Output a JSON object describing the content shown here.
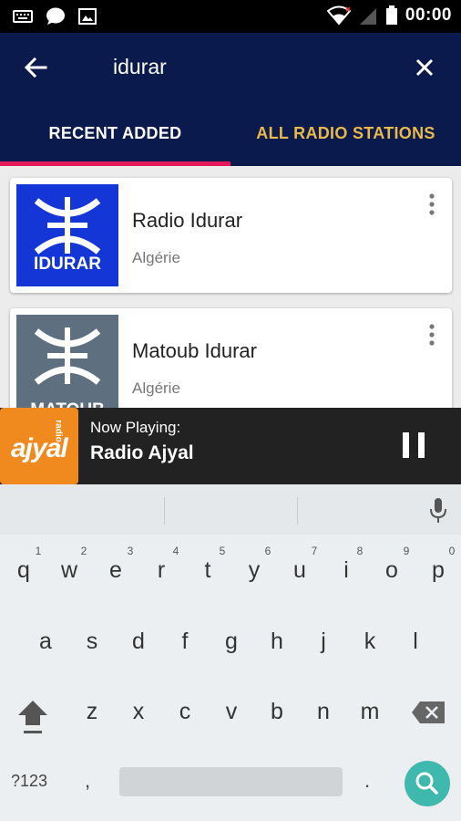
{
  "status_bar": {
    "time": "00:00"
  },
  "search": {
    "query": "idurar"
  },
  "tabs": [
    {
      "label": "RECENT ADDED",
      "active": true
    },
    {
      "label": "ALL RADIO STATIONS",
      "active": false
    }
  ],
  "stations": [
    {
      "name": "Radio Idurar",
      "country": "Algérie",
      "logo_text": "IDURAR",
      "logo_color": "#1536d6"
    },
    {
      "name": "Matoub Idurar",
      "country": "Algérie",
      "logo_text": "MATOUB",
      "logo_color": "#5e6f80"
    }
  ],
  "now_playing": {
    "label": "Now Playing:",
    "station": "Radio Ajyal",
    "logo_text": "ajyal",
    "logo_sub": "radio",
    "logo_color": "#f08a1f"
  },
  "keyboard": {
    "row1": [
      "q",
      "w",
      "e",
      "r",
      "t",
      "y",
      "u",
      "i",
      "o",
      "p"
    ],
    "row1_nums": [
      "1",
      "2",
      "3",
      "4",
      "5",
      "6",
      "7",
      "8",
      "9",
      "0"
    ],
    "row2": [
      "a",
      "s",
      "d",
      "f",
      "g",
      "h",
      "j",
      "k",
      "l"
    ],
    "row3": [
      "z",
      "x",
      "c",
      "v",
      "b",
      "n",
      "m"
    ],
    "symbols_label": "?123",
    "comma": ",",
    "period": "."
  },
  "colors": {
    "appbar": "#0b1a4d",
    "tab_active_text": "#ffffff",
    "tab_inactive_text": "#e9b949",
    "tab_indicator": "#e6195b",
    "search_key": "#3fb8ad"
  }
}
